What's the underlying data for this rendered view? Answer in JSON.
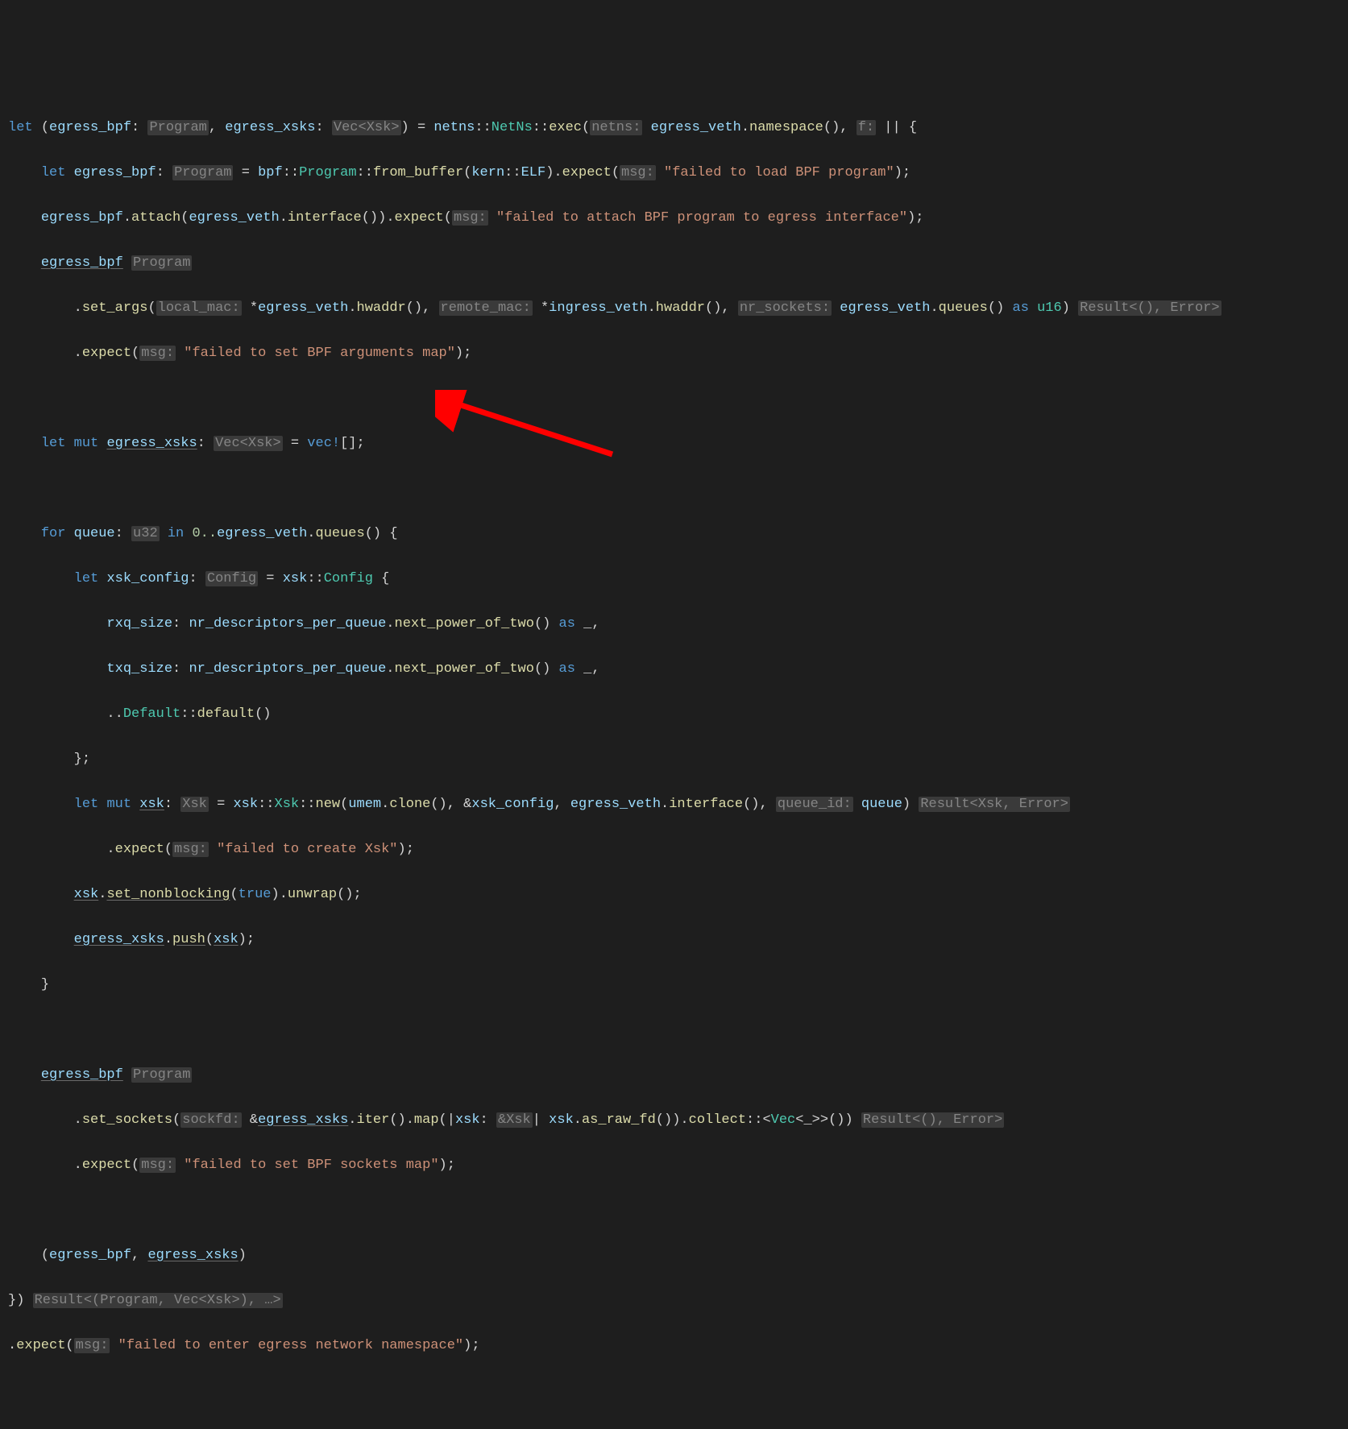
{
  "code": {
    "l1": {
      "kw_let": "let",
      "lparen": "(",
      "v1": "egress_bpf",
      "colon1": ":",
      "hint1": "Program",
      "comma1": ",",
      "v2": "egress_xsks",
      "colon2": ":",
      "hint2": "Vec<Xsk>",
      "rparen": ")",
      "eq": "=",
      "ns1": "netns",
      "dcolon1": "::",
      "ns2": "NetNs",
      "dcolon2": "::",
      "fn1": "exec",
      "lparen2": "(",
      "hint3": "netns:",
      "v3": "egress_veth",
      "dot1": ".",
      "fn2": "namespace",
      "parens1": "(),",
      "hint4": "f:",
      "closure": "|| {"
    },
    "l2": {
      "kw_let": "let",
      "v1": "egress_bpf",
      "colon": ":",
      "hint1": "Program",
      "eq": "=",
      "ns1": "bpf",
      "dcolon1": "::",
      "ns2": "Program",
      "dcolon2": "::",
      "fn1": "from_buffer",
      "lparen": "(",
      "ns3": "kern",
      "dcolon3": "::",
      "const1": "ELF",
      "rparen": ")",
      "dot": ".",
      "fn2": "expect",
      "lparen2": "(",
      "hint2": "msg:",
      "str": "\"failed to load BPF program\"",
      "rparen2": ");"
    },
    "l3": {
      "v1": "egress_bpf",
      "dot1": ".",
      "fn1": "attach",
      "lparen1": "(",
      "v2": "egress_veth",
      "dot2": ".",
      "fn2": "interface",
      "parens1": "())",
      "dot3": ".",
      "fn3": "expect",
      "lparen2": "(",
      "hint1": "msg:",
      "str": "\"failed to attach BPF program to egress interface\"",
      "rparen2": ");"
    },
    "l4": {
      "v1": "egress_bpf",
      "hint1": "Program"
    },
    "l5": {
      "dot": ".",
      "fn": "set_args",
      "lparen": "(",
      "hint1": "local_mac:",
      "star1": "*",
      "v1": "egress_veth",
      "dot1": ".",
      "fn1": "hwaddr",
      "parens1": "(),",
      "hint2": "remote_mac:",
      "star2": "*",
      "v2": "ingress_veth",
      "dot2": ".",
      "fn2": "hwaddr",
      "parens2": "(),",
      "hint3": "nr_sockets:",
      "v3": "egress_veth",
      "dot3": ".",
      "fn3": "queues",
      "parens3": "()",
      "kw_as": "as",
      "type": "u16",
      "rparen": ")",
      "hint4": "Result<(), Error>"
    },
    "l6": {
      "dot": ".",
      "fn": "expect",
      "lparen": "(",
      "hint": "msg:",
      "str": "\"failed to set BPF arguments map\"",
      "rparen": ");"
    },
    "l7": {
      "empty": ""
    },
    "l8": {
      "kw_let": "let",
      "kw_mut": "mut",
      "v1": "egress_xsks",
      "colon": ":",
      "hint1": "Vec<Xsk>",
      "eq": "=",
      "macro": "vec!",
      "brackets": "[];"
    },
    "l9": {
      "empty": ""
    },
    "l10": {
      "kw_for": "for",
      "v1": "queue",
      "colon": ":",
      "hint1": "u32",
      "kw_in": "in",
      "range": "0..",
      "v2": "egress_veth",
      "dot": ".",
      "fn": "queues",
      "parens": "() {"
    },
    "l11": {
      "kw_let": "let",
      "v1": "xsk_config",
      "colon": ":",
      "hint1": "Config",
      "eq": "=",
      "ns1": "xsk",
      "dcolon": "::",
      "type": "Config",
      "brace": " {"
    },
    "l12": {
      "field": "rxq_size",
      "colon": ":",
      "v1": "nr_descriptors_per_queue",
      "dot": ".",
      "fn": "next_power_of_two",
      "parens": "()",
      "kw_as": "as",
      "under": "_",
      "comma": ","
    },
    "l13": {
      "field": "txq_size",
      "colon": ":",
      "v1": "nr_descriptors_per_queue",
      "dot": ".",
      "fn": "next_power_of_two",
      "parens": "()",
      "kw_as": "as",
      "under": "_",
      "comma": ","
    },
    "l14": {
      "spread": "..",
      "ns": "Default",
      "dcolon": "::",
      "fn": "default",
      "parens": "()"
    },
    "l15": {
      "close": "};"
    },
    "l16": {
      "kw_let": "let",
      "kw_mut": "mut",
      "v1": "xsk",
      "colon": ":",
      "hint1": "Xsk",
      "eq": "=",
      "ns1": "xsk",
      "dcolon1": "::",
      "ns2": "Xsk",
      "dcolon2": "::",
      "fn": "new",
      "lparen": "(",
      "v2": "umem",
      "dot1": ".",
      "fn1": "clone",
      "parens1": "(),",
      "amp": "&",
      "v3": "xsk_config",
      "comma1": ",",
      "v4": "egress_veth",
      "dot2": ".",
      "fn2": "interface",
      "parens2": "(),",
      "hint2": "queue_id:",
      "v5": "queue",
      "rparen": ")",
      "hint3": "Result<Xsk, Error>"
    },
    "l17": {
      "dot": ".",
      "fn": "expect",
      "lparen": "(",
      "hint": "msg:",
      "str": "\"failed to create Xsk\"",
      "rparen": ");"
    },
    "l18": {
      "v1": "xsk",
      "dot1": ".",
      "fn1": "set_nonblocking",
      "lparen": "(",
      "bool": "true",
      "rparen": ")",
      "dot2": ".",
      "fn2": "unwrap",
      "parens": "();"
    },
    "l19": {
      "v1": "egress_xsks",
      "dot": ".",
      "fn": "push",
      "lparen": "(",
      "v2": "xsk",
      "rparen": ");"
    },
    "l20": {
      "close": "}"
    },
    "l21": {
      "empty": ""
    },
    "l22": {
      "v1": "egress_bpf",
      "hint1": "Program"
    },
    "l23": {
      "dot1": ".",
      "fn1": "set_sockets",
      "lparen1": "(",
      "hint1": "sockfd:",
      "amp": "&",
      "v1": "egress_xsks",
      "dot2": ".",
      "fn2": "iter",
      "parens2": "().",
      "fn3": "map",
      "lparen2": "(|",
      "v2": "xsk",
      "colon": ":",
      "hint2": "&Xsk",
      "pipe": "|",
      "v3": "xsk",
      "dot3": ".",
      "fn4": "as_raw_fd",
      "parens3": "())",
      "dot4": ".",
      "fn5": "collect",
      "turbo": "::",
      "lt": "<",
      "type": "Vec",
      "lt2": "<",
      "under": "_",
      "gt2": ">>",
      "parens4": "())",
      "hint3": "Result<(), Error>"
    },
    "l24": {
      "dot": ".",
      "fn": "expect",
      "lparen": "(",
      "hint": "msg:",
      "str": "\"failed to set BPF sockets map\"",
      "rparen": ");"
    },
    "l25": {
      "empty": ""
    },
    "l26": {
      "lparen": "(",
      "v1": "egress_bpf",
      "comma": ",",
      "v2": "egress_xsks",
      "rparen": ")"
    },
    "l27": {
      "close": "})",
      "hint": "Result<(Program, Vec<Xsk>), …>"
    },
    "l28": {
      "dot": ".",
      "fn": "expect",
      "lparen": "(",
      "hint": "msg:",
      "str": "\"failed to enter egress network namespace\"",
      "rparen": ");"
    }
  }
}
